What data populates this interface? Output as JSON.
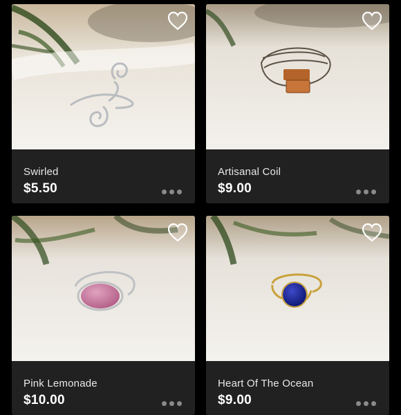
{
  "listings": [
    {
      "title": "Swirled",
      "price": "$5.50",
      "photo_icon": "silver-swirl-ring",
      "favorited": false
    },
    {
      "title": "Artisanal Coil",
      "price": "$9.00",
      "photo_icon": "coil-ring-amber-stone",
      "favorited": false
    },
    {
      "title": "Pink Lemonade",
      "price": "$10.00",
      "photo_icon": "pink-stone-ring",
      "favorited": false
    },
    {
      "title": "Heart Of The Ocean",
      "price": "$9.00",
      "photo_icon": "gold-ring-blue-stone",
      "favorited": false
    }
  ],
  "icons": {
    "favorite": "heart-outline-icon",
    "more": "more-dots-icon"
  },
  "colors": {
    "card_background": "#212121",
    "page_background": "#000000",
    "text": "#ffffff"
  }
}
